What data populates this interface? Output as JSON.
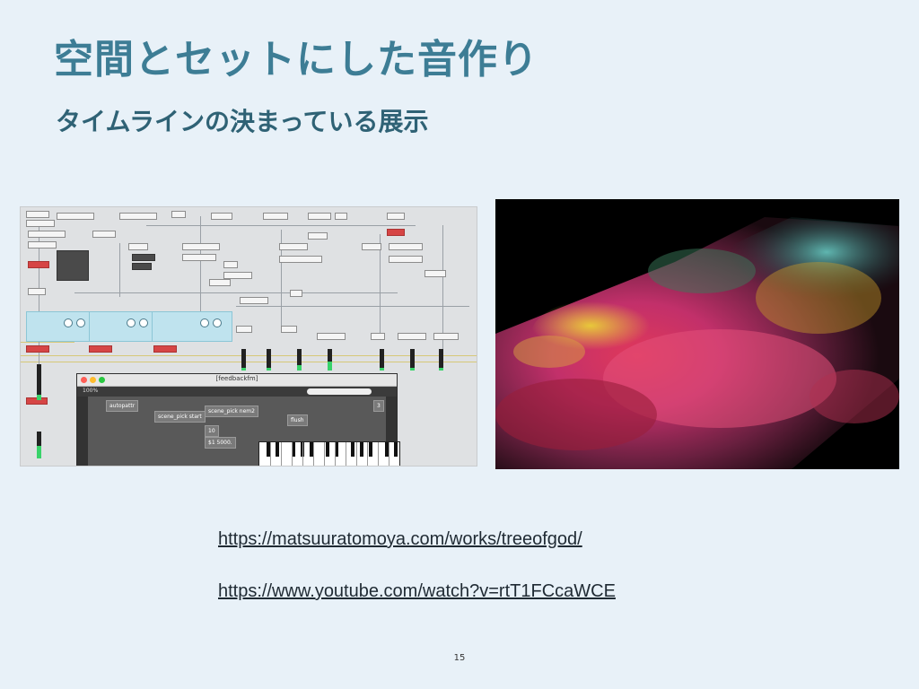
{
  "slide": {
    "title": "空間とセットにした音作り",
    "subtitle": "タイムラインの決まっている展示",
    "links": [
      "https://matsuuratomoya.com/works/treeofgod/",
      "https://www.youtube.com/watch?v=rtT1FCcaWCE"
    ],
    "page_number": "15"
  },
  "patcher_screenshot": {
    "window_title": "[feedbackfm]",
    "zoom": "100%",
    "send_box": [
      "chime_gain",
      "downmix 3",
      "fm_gain"
    ],
    "objects": [
      "autopattr",
      "scene_pick start",
      "scene_pick nem2",
      "flush",
      "10",
      "$1 5000."
    ],
    "number_box": "3"
  },
  "photo": {
    "description_icon": "projection-flowers-photo"
  },
  "colors": {
    "title": "#3d7d95",
    "subtitle": "#2f6275",
    "background": "#e8f1f8"
  }
}
